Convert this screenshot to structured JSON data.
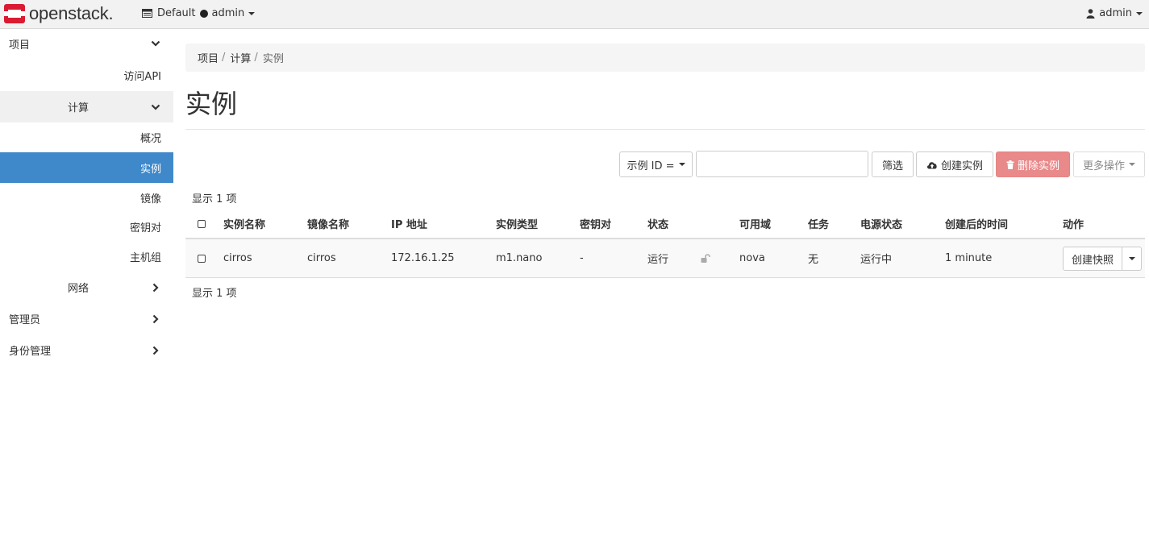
{
  "navbar": {
    "brand": "openstack.",
    "project_domain": "Default",
    "project_name": "admin",
    "user": "admin"
  },
  "sidebar": {
    "project": "项目",
    "api_access": "访问API",
    "compute": "计算",
    "overview": "概况",
    "instances": "实例",
    "images": "镜像",
    "key_pairs": "密钥对",
    "host_groups": "主机组",
    "network": "网络",
    "admin": "管理员",
    "identity": "身份管理"
  },
  "breadcrumb": [
    "项目",
    "计算",
    "实例"
  ],
  "page_title": "实例",
  "toolbar": {
    "filter_field": "示例 ID =",
    "filter_value": "",
    "filter_button": "筛选",
    "launch_button": "创建实例",
    "delete_button": "删除实例",
    "more_button": "更多操作"
  },
  "count_text": "显示 1 项",
  "table": {
    "headers": {
      "name": "实例名称",
      "image": "镜像名称",
      "ip": "IP 地址",
      "flavor": "实例类型",
      "keypair": "密钥对",
      "status": "状态",
      "az": "可用域",
      "task": "任务",
      "power": "电源状态",
      "age": "创建后的时间",
      "actions": "动作"
    },
    "rows": [
      {
        "name": "cirros",
        "image": "cirros",
        "ip": "172.16.1.25",
        "flavor": "m1.nano",
        "keypair": "-",
        "status": "运行",
        "az": "nova",
        "task": "无",
        "power": "运行中",
        "age": "1 minute",
        "action": "创建快照"
      }
    ]
  },
  "colors": {
    "accent": "#3f89cb",
    "link": "#337ab7",
    "danger": "#e9898a",
    "brand_red": "#da1a32"
  }
}
